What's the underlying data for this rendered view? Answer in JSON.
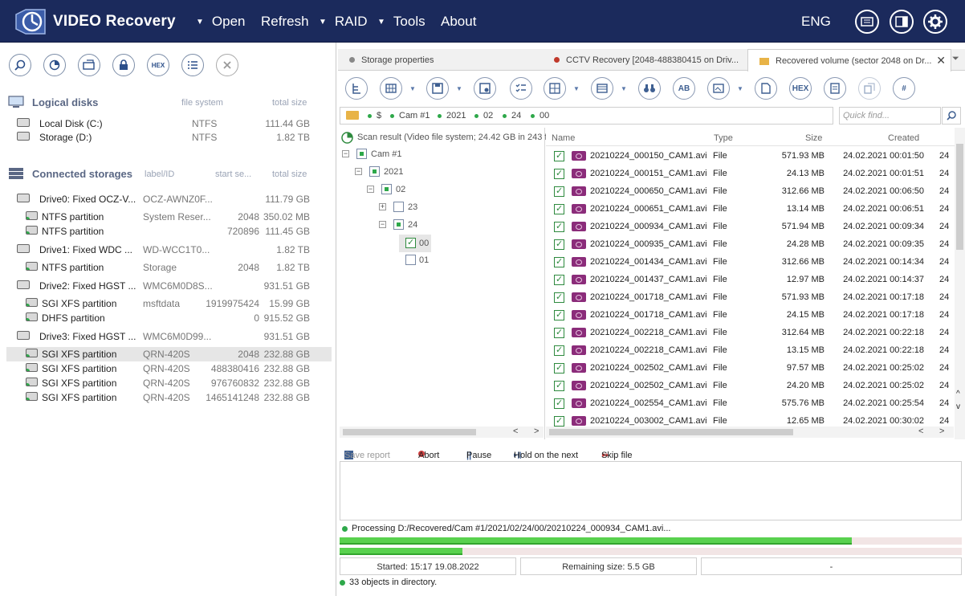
{
  "app": {
    "title": "VIDEO Recovery",
    "lang": "ENG"
  },
  "menu": {
    "open": "Open",
    "refresh": "Refresh",
    "raid": "RAID",
    "tools": "Tools",
    "about": "About"
  },
  "left": {
    "logical_title": "Logical disks",
    "logical_col_fs": "file system",
    "logical_col_size": "total size",
    "logical_disks": [
      {
        "name": "Local Disk (C:)",
        "fs": "NTFS",
        "size": "111.44 GB"
      },
      {
        "name": "Storage (D:)",
        "fs": "NTFS",
        "size": "1.82 TB"
      }
    ],
    "connected_title": "Connected storages",
    "connected_col_label": "label/ID",
    "connected_col_start": "start se...",
    "connected_col_size": "total size",
    "drives": [
      {
        "name": "Drive0: Fixed OCZ-V...",
        "label": "OCZ-AWNZ0F...",
        "start": "",
        "size": "111.79 GB"
      },
      {
        "name": "NTFS partition",
        "label": "System Reser...",
        "start": "2048",
        "size": "350.02 MB"
      },
      {
        "name": "NTFS partition",
        "label": "",
        "start": "720896",
        "size": "111.45 GB"
      },
      {
        "name": "Drive1: Fixed WDC ...",
        "label": "WD-WCC1T0...",
        "start": "",
        "size": "1.82 TB"
      },
      {
        "name": "NTFS partition",
        "label": "Storage",
        "start": "2048",
        "size": "1.82 TB"
      },
      {
        "name": "Drive2: Fixed HGST ...",
        "label": "WMC6M0D8S...",
        "start": "",
        "size": "931.51 GB"
      },
      {
        "name": "SGI XFS partition",
        "label": "msftdata",
        "start": "1919975424",
        "size": "15.99 GB"
      },
      {
        "name": "DHFS partition",
        "label": "",
        "start": "0",
        "size": "915.52 GB"
      },
      {
        "name": "Drive3: Fixed HGST ...",
        "label": "WMC6M0D99...",
        "start": "",
        "size": "931.51 GB"
      },
      {
        "name": "SGI XFS partition",
        "label": "QRN-420S",
        "start": "2048",
        "size": "232.88 GB"
      },
      {
        "name": "SGI XFS partition",
        "label": "QRN-420S",
        "start": "488380416",
        "size": "232.88 GB"
      },
      {
        "name": "SGI XFS partition",
        "label": "QRN-420S",
        "start": "976760832",
        "size": "232.88 GB"
      },
      {
        "name": "SGI XFS partition",
        "label": "QRN-420S",
        "start": "1465141248",
        "size": "232.88 GB"
      }
    ]
  },
  "tabs": [
    {
      "label": "Storage properties"
    },
    {
      "label": "CCTV Recovery [2048-488380415 on Driv..."
    },
    {
      "label": "Recovered volume (sector 2048 on Dr..."
    }
  ],
  "toolbar": {
    "hex": "HEX",
    "ab": "AB",
    "hash": "#"
  },
  "path": {
    "segments": [
      "$",
      "Cam #1",
      "2021",
      "02",
      "24",
      "00"
    ]
  },
  "quick_find": {
    "placeholder": "Quick find..."
  },
  "tree": {
    "root_label": "Scan result (Video file system; 24.42 GB in 243 fi",
    "nodes": [
      "Cam #1",
      "2021",
      "02",
      "23",
      "24",
      "00",
      "01"
    ]
  },
  "files": {
    "col_name": "Name",
    "col_type": "Type",
    "col_size": "Size",
    "col_created": "Created",
    "rows": [
      {
        "name": "20210224_000150_CAM1.avi",
        "type": "File",
        "size": "571.93 MB",
        "created": "24.02.2021 00:01:50",
        "extra": "24"
      },
      {
        "name": "20210224_000151_CAM1.avi",
        "type": "File",
        "size": "24.13 MB",
        "created": "24.02.2021 00:01:51",
        "extra": "24"
      },
      {
        "name": "20210224_000650_CAM1.avi",
        "type": "File",
        "size": "312.66 MB",
        "created": "24.02.2021 00:06:50",
        "extra": "24"
      },
      {
        "name": "20210224_000651_CAM1.avi",
        "type": "File",
        "size": "13.14 MB",
        "created": "24.02.2021 00:06:51",
        "extra": "24"
      },
      {
        "name": "20210224_000934_CAM1.avi",
        "type": "File",
        "size": "571.94 MB",
        "created": "24.02.2021 00:09:34",
        "extra": "24"
      },
      {
        "name": "20210224_000935_CAM1.avi",
        "type": "File",
        "size": "24.28 MB",
        "created": "24.02.2021 00:09:35",
        "extra": "24"
      },
      {
        "name": "20210224_001434_CAM1.avi",
        "type": "File",
        "size": "312.66 MB",
        "created": "24.02.2021 00:14:34",
        "extra": "24"
      },
      {
        "name": "20210224_001437_CAM1.avi",
        "type": "File",
        "size": "12.97 MB",
        "created": "24.02.2021 00:14:37",
        "extra": "24"
      },
      {
        "name": "20210224_001718_CAM1.avi",
        "type": "File",
        "size": "571.93 MB",
        "created": "24.02.2021 00:17:18",
        "extra": "24"
      },
      {
        "name": "20210224_001718_CAM1.avi",
        "type": "File",
        "size": "24.15 MB",
        "created": "24.02.2021 00:17:18",
        "extra": "24"
      },
      {
        "name": "20210224_002218_CAM1.avi",
        "type": "File",
        "size": "312.64 MB",
        "created": "24.02.2021 00:22:18",
        "extra": "24"
      },
      {
        "name": "20210224_002218_CAM1.avi",
        "type": "File",
        "size": "13.15 MB",
        "created": "24.02.2021 00:22:18",
        "extra": "24"
      },
      {
        "name": "20210224_002502_CAM1.avi",
        "type": "File",
        "size": "97.57 MB",
        "created": "24.02.2021 00:25:02",
        "extra": "24"
      },
      {
        "name": "20210224_002502_CAM1.avi",
        "type": "File",
        "size": "24.20 MB",
        "created": "24.02.2021 00:25:02",
        "extra": "24"
      },
      {
        "name": "20210224_002554_CAM1.avi",
        "type": "File",
        "size": "575.76 MB",
        "created": "24.02.2021 00:25:54",
        "extra": "24"
      },
      {
        "name": "20210224_003002_CAM1.avi",
        "type": "File",
        "size": "12.65 MB",
        "created": "24.02.2021 00:30:02",
        "extra": "24"
      }
    ]
  },
  "log": {
    "save": "Save report",
    "abort": "Abort",
    "pause": "Pause",
    "hold": "Hold on the next",
    "skip": "Skip file"
  },
  "progress": {
    "processing": "Processing D:/Recovered/Cam #1/2021/02/24/00/20210224_000934_CAM1.avi...",
    "bar1_fraction": 0.823,
    "bar2_fraction": 0.197
  },
  "stats": {
    "started": "Started: 15:17 19.08.2022",
    "remaining": "Remaining size: 5.5 GB",
    "third": "-"
  },
  "status": {
    "text": "33 objects in directory."
  },
  "colors": {
    "topbar": "#1b2a5c",
    "accent_green": "#2ea84a",
    "file_icon": "#8b2c7a"
  }
}
